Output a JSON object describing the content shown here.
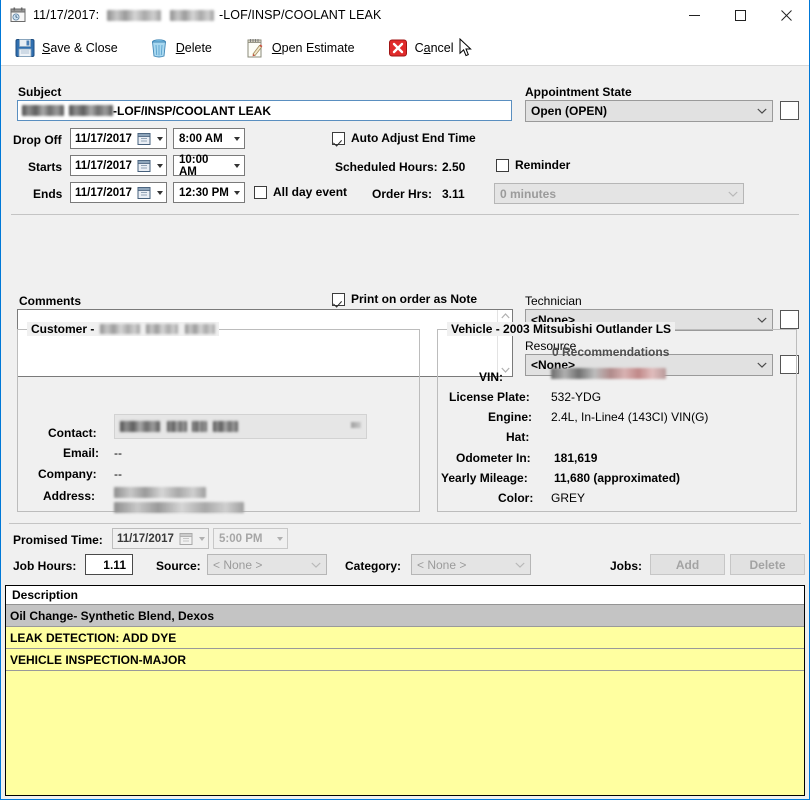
{
  "window": {
    "title_date": "11/17/2017:",
    "title_suffix": "-LOF/INSP/COOLANT LEAK",
    "icon": "calendar-icon",
    "minimize_label": "Minimize",
    "maximize_label": "Maximize",
    "close_label": "Close",
    "accent_color": "#0078d7"
  },
  "toolbar": {
    "save_close": "Save & Close",
    "delete": "Delete",
    "open_estimate": "Open Estimate",
    "cancel": "Cancel",
    "icons": [
      "floppy-disk-icon",
      "trash-can-icon",
      "notepad-pencil-icon",
      "red-x-icon"
    ]
  },
  "subject": {
    "label": "Subject",
    "value_suffix": "-LOF/INSP/COOLANT LEAK",
    "value_redacted": true
  },
  "appointment_state": {
    "label": "Appointment State",
    "value": "Open (OPEN)"
  },
  "schedule": {
    "drop_off_label": "Drop Off",
    "drop_off_date": "11/17/2017",
    "drop_off_time": "8:00 AM",
    "starts_label": "Starts",
    "starts_date": "11/17/2017",
    "starts_time": "10:00 AM",
    "ends_label": "Ends",
    "ends_date": "11/17/2017",
    "ends_time": "12:30 PM",
    "all_day_label": "All day event",
    "all_day_checked": false,
    "auto_adjust_label": "Auto Adjust End Time",
    "auto_adjust_checked": true,
    "scheduled_hours_label": "Scheduled Hours:",
    "scheduled_hours_value": "2.50",
    "order_hrs_label": "Order Hrs:",
    "order_hrs_value": "3.11",
    "reminder_label": "Reminder",
    "reminder_checked": false,
    "reminder_value": "0 minutes"
  },
  "comments": {
    "label": "Comments",
    "value": "",
    "print_note_label": "Print on order as Note",
    "print_note_checked": true
  },
  "assignment": {
    "technician_label": "Technician",
    "technician_value": "<None>",
    "resource_label": "Resource",
    "resource_value": "<None>"
  },
  "customer": {
    "group_label": "Customer -",
    "name_redacted": true,
    "contact_label": "Contact:",
    "contact_redacted": true,
    "email_label": "Email:",
    "email_value": "--",
    "company_label": "Company:",
    "company_value": "--",
    "address_label": "Address:",
    "address_redacted": true
  },
  "vehicle": {
    "group_label": "Vehicle - 2003 Mitsubishi Outlander LS",
    "recommendations": "0 Recommendations",
    "rows": [
      {
        "label": "VIN:",
        "value": "",
        "redacted": true
      },
      {
        "label": "License Plate:",
        "value": "532-YDG",
        "redacted": false
      },
      {
        "label": "Engine:",
        "value": "2.4L, In-Line4 (143CI) VIN(G)",
        "redacted": false
      },
      {
        "label": "Hat:",
        "value": "",
        "redacted": false
      },
      {
        "label": "Odometer In:",
        "value": "181,619",
        "redacted": false,
        "bold": true
      },
      {
        "label": "Yearly Mileage:",
        "value": "11,680 (approximated)",
        "redacted": false,
        "bold": true
      },
      {
        "label": "Color:",
        "value": "GREY",
        "redacted": false
      }
    ]
  },
  "footer": {
    "promised_time_label": "Promised Time:",
    "promised_date": "11/17/2017",
    "promised_time": "5:00 PM",
    "job_hours_label": "Job Hours:",
    "job_hours_value": "1.11",
    "source_label": "Source:",
    "source_value": "< None >",
    "category_label": "Category:",
    "category_value": "< None >",
    "jobs_label": "Jobs:",
    "jobs_add": "Add",
    "jobs_delete": "Delete"
  },
  "description_grid": {
    "header": "Description",
    "rows": [
      {
        "text": "Oil Change- Synthetic Blend, Dexos",
        "selected": true
      },
      {
        "text": "LEAK DETECTION: ADD DYE",
        "selected": false
      },
      {
        "text": "VEHICLE INSPECTION-MAJOR",
        "selected": false
      }
    ],
    "row_bg": "#ffffa0",
    "selected_bg": "#c4c4c4"
  }
}
